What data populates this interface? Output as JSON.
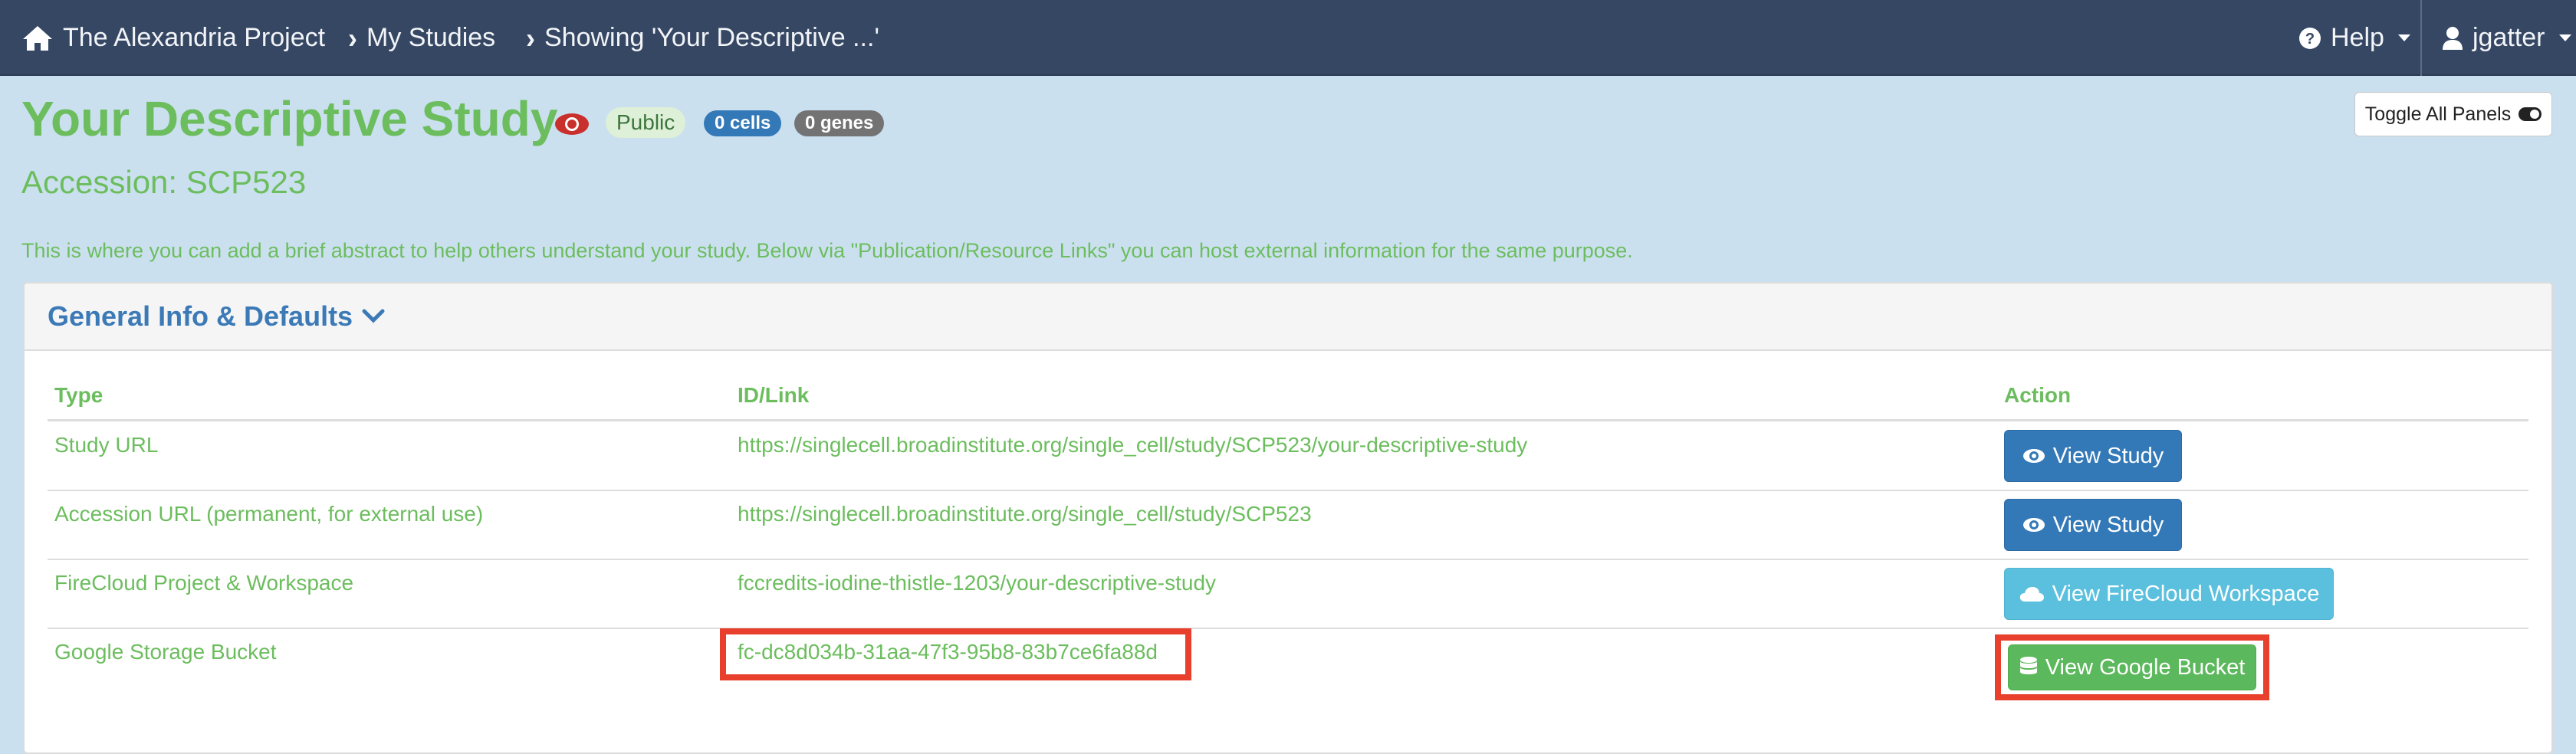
{
  "navbar": {
    "brand": "The Alexandria Project",
    "my_studies": "My Studies",
    "showing": "Showing 'Your Descriptive ...'",
    "help": "Help",
    "user": "jgatter"
  },
  "header": {
    "title": "Your Descriptive Study",
    "public_badge": "Public",
    "cells_badge": "0 cells",
    "genes_badge": "0 genes",
    "toggle_panels": "Toggle All Panels",
    "accession": "Accession: SCP523",
    "abstract": "This is where you can add a brief abstract to help others understand your study. Below via \"Publication/Resource Links\" you can host external information for the same purpose."
  },
  "panel": {
    "title": "General Info & Defaults",
    "columns": [
      "Type",
      "ID/Link",
      "Action"
    ],
    "rows": [
      {
        "type": "Study URL",
        "link": "https://singlecell.broadinstitute.org/single_cell/study/SCP523/your-descriptive-study",
        "action": "View Study"
      },
      {
        "type": "Accession URL (permanent, for external use)",
        "link": "https://singlecell.broadinstitute.org/single_cell/study/SCP523",
        "action": "View Study"
      },
      {
        "type": "FireCloud Project & Workspace",
        "link": "fccredits-iodine-thistle-1203/your-descriptive-study",
        "action": "View FireCloud Workspace"
      },
      {
        "type": "Google Storage Bucket",
        "link": "fc-dc8d034b-31aa-47f3-95b8-83b7ce6fa88d",
        "action": "View Google Bucket"
      }
    ]
  },
  "colors": {
    "navbar": "#354763",
    "background": "#cbe0ef",
    "green_text": "#6cbd5e",
    "primary_button": "#3479b7",
    "info_button": "#5bc0de",
    "success_button": "#5cb85c",
    "highlight_box": "#e8402d"
  },
  "icons": [
    "home-icon",
    "chevron-right-icon",
    "question-circle-icon",
    "user-icon",
    "eye-icon",
    "toggle-icon",
    "chevron-down-icon",
    "cloud-icon",
    "database-icon"
  ]
}
